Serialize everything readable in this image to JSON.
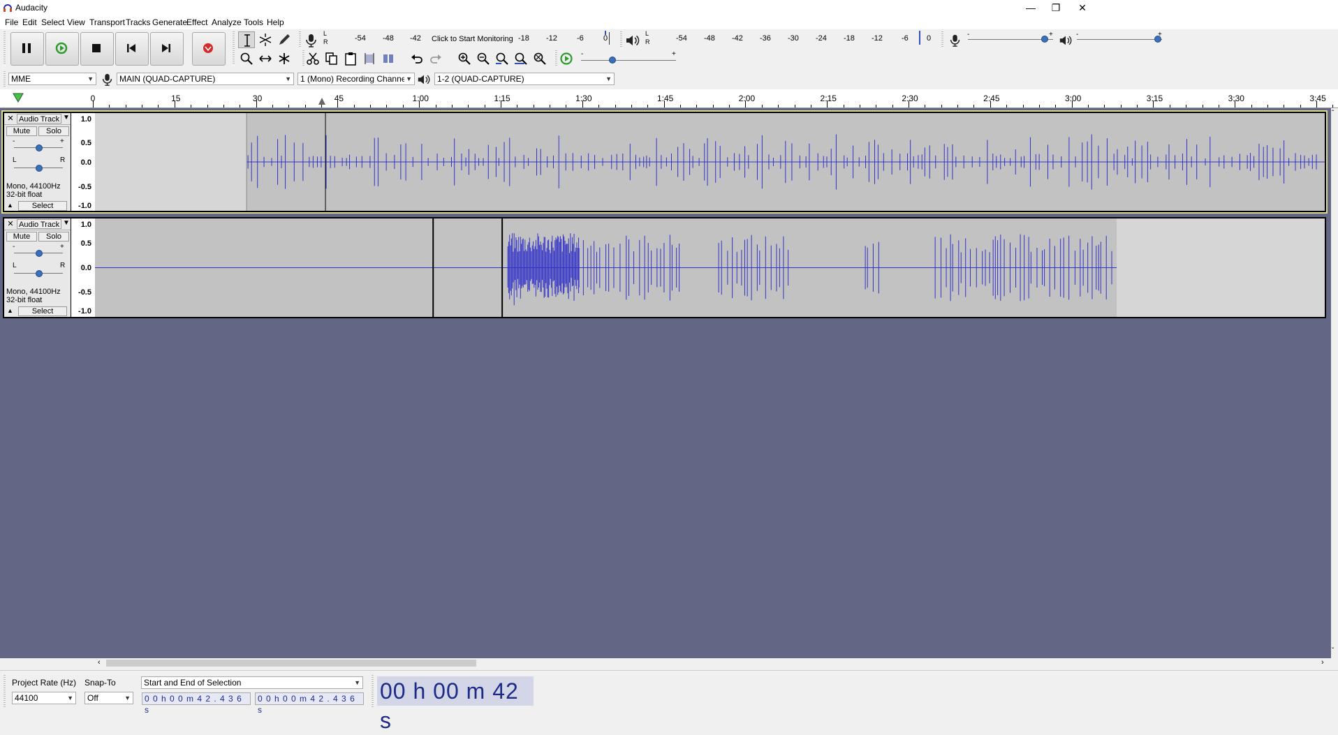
{
  "window": {
    "title": "Audacity",
    "minimize": "—",
    "restore": "❐",
    "close": "✕"
  },
  "menu": [
    "File",
    "Edit",
    "Select",
    "View",
    "Transport",
    "Tracks",
    "Generate",
    "Effect",
    "Analyze",
    "Tools",
    "Help"
  ],
  "recording_meter": {
    "labels": [
      "-54",
      "-48",
      "-42",
      "-18",
      "-12",
      "-6",
      "0"
    ],
    "click_text": "Click to Start Monitoring",
    "lr_l": "L",
    "lr_r": "R"
  },
  "playback_meter": {
    "labels": [
      "-54",
      "-48",
      "-42",
      "-36",
      "-30",
      "-24",
      "-18",
      "-12",
      "-6",
      "0"
    ],
    "lr_l": "L",
    "lr_r": "R"
  },
  "mixer": {
    "rec_minus": "-",
    "rec_plus": "+",
    "play_minus": "-",
    "play_plus": "+",
    "rec_level": 0.9,
    "play_level": 0.95
  },
  "play_at_speed": {
    "minus": "-",
    "plus": "+",
    "level": 0.33
  },
  "device": {
    "host": "MME",
    "recording_device": "MAIN (QUAD-CAPTURE)",
    "channels": "1 (Mono) Recording Channels",
    "playback_device": "1-2 (QUAD-CAPTURE)"
  },
  "timeline": {
    "labels": [
      "0",
      "15",
      "30",
      "45",
      "1:00",
      "1:15",
      "1:30",
      "1:45",
      "2:00",
      "2:15",
      "2:30",
      "2:45",
      "3:00",
      "3:15",
      "3:30",
      "3:45"
    ],
    "play_position_seconds": 42
  },
  "tracks": [
    {
      "name": "Audio Track",
      "mute": "Mute",
      "solo": "Solo",
      "gain_minus": "-",
      "gain_plus": "+",
      "pan_l": "L",
      "pan_r": "R",
      "info_line1": "Mono, 44100Hz",
      "info_line2": "32-bit float",
      "select": "Select",
      "scale": [
        "1.0",
        "0.5",
        "0.0",
        "-0.5",
        "-1.0"
      ],
      "clip_start_seconds": 27.5,
      "clip_end_seconds": 230
    },
    {
      "name": "Audio Track",
      "mute": "Mute",
      "solo": "Solo",
      "gain_minus": "-",
      "gain_plus": "+",
      "pan_l": "L",
      "pan_r": "R",
      "info_line1": "Mono, 44100Hz",
      "info_line2": "32-bit float",
      "select": "Select",
      "scale": [
        "1.0",
        "0.5",
        "0.0",
        "-0.5",
        "-1.0"
      ],
      "clip_boundaries_seconds": [
        0,
        61.8,
        74.5,
        187.5
      ]
    }
  ],
  "selection_toolbar": {
    "project_rate_label": "Project Rate (Hz)",
    "project_rate": "44100",
    "snap_to_label": "Snap-To",
    "snap_to": "Off",
    "selection_mode": "Start and End of Selection",
    "start": "0 0 h 0 0 m 4 2 . 4 3 6 s",
    "end": "0 0 h 0 0 m 4 2 . 4 3 6 s",
    "audio_position": "00 h 00 m 42 s"
  },
  "colors": {
    "track_bg": "#636785",
    "waveform": "#3232c8",
    "clip_bg": "#c2c2c2",
    "time_text": "#1d2a88"
  }
}
